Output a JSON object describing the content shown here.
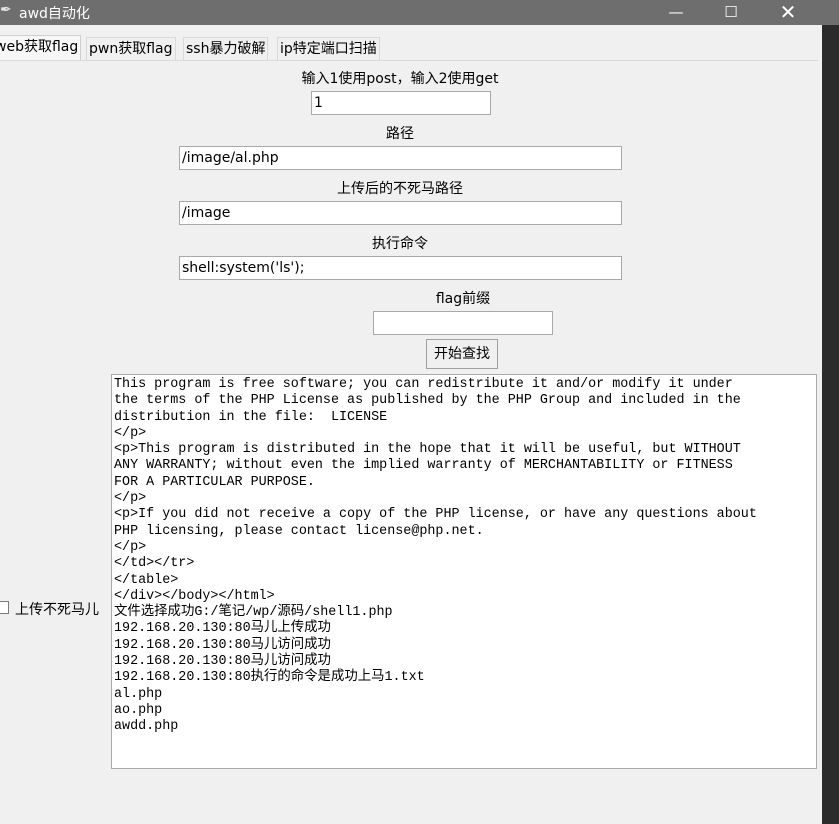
{
  "window": {
    "title": "awd自动化",
    "app_icon": "feather-icon",
    "minimize_glyph": "—",
    "maximize_glyph": "☐",
    "close_glyph": "✕"
  },
  "tabs": [
    {
      "label": "web获取flag",
      "active": true
    },
    {
      "label": "pwn获取flag",
      "active": false
    },
    {
      "label": "ssh暴力破解",
      "active": false
    },
    {
      "label": "ip特定端口扫描",
      "active": false
    }
  ],
  "form": {
    "method_label": "输入1使用post，输入2使用get",
    "method_value": "1",
    "path_label": "路径",
    "path_value": "/image/al.php",
    "upload_path_label": "上传后的不死马路径",
    "upload_path_value": "/image",
    "command_label": "执行命令",
    "command_value": "shell:system('ls');",
    "flag_prefix_label": "flag前缀",
    "flag_prefix_value": "",
    "start_button": "开始查找",
    "upload_checkbox_label": "上传不死马儿",
    "upload_checkbox_checked": false
  },
  "output": {
    "lines": [
      "This program is free software; you can redistribute it and/or modify it under",
      "the terms of the PHP License as published by the PHP Group and included in the",
      "distribution in the file:  LICENSE",
      "</p>",
      "<p>This program is distributed in the hope that it will be useful, but WITHOUT",
      "ANY WARRANTY; without even the implied warranty of MERCHANTABILITY or FITNESS",
      "FOR A PARTICULAR PURPOSE.",
      "</p>",
      "<p>If you did not receive a copy of the PHP license, or have any questions about",
      "PHP licensing, please contact license@php.net.",
      "</p>",
      "</td></tr>",
      "</table>",
      "</div></body></html>",
      "文件选择成功G:/笔记/wp/源码/shell1.php",
      "192.168.20.130:80马儿上传成功",
      "192.168.20.130:80马儿访问成功",
      "192.168.20.130:80马儿访问成功",
      "192.168.20.130:80执行的命令是成功上马1.txt",
      "al.php",
      "ao.php",
      "awdd.php"
    ]
  }
}
